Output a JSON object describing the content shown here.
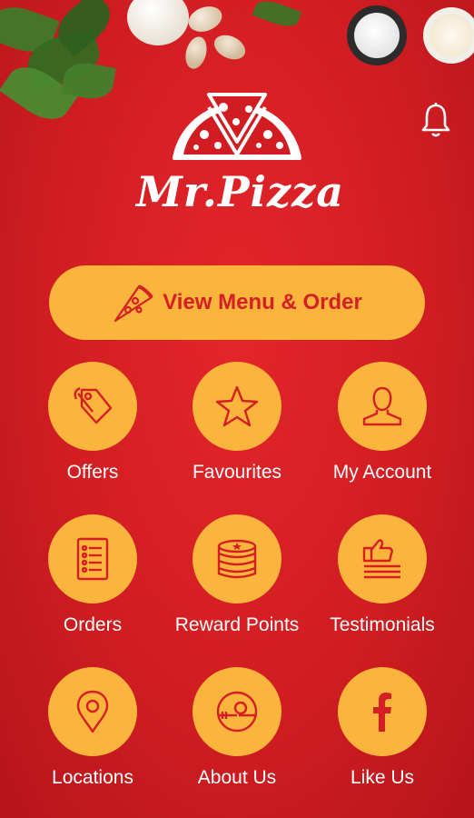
{
  "app": {
    "name": "Mr.Pizza"
  },
  "header": {
    "notification_icon": "bell-icon"
  },
  "cta": {
    "label": "View Menu & Order",
    "icon": "pizza-slice-icon"
  },
  "colors": {
    "background": "#d11d22",
    "accent": "#fbb53c",
    "accent_text": "#d51f25",
    "text": "#ffffff"
  },
  "menu": [
    {
      "label": "Offers",
      "icon": "tag-icon"
    },
    {
      "label": "Favourites",
      "icon": "star-icon"
    },
    {
      "label": "My Account",
      "icon": "user-icon"
    },
    {
      "label": "Orders",
      "icon": "list-icon"
    },
    {
      "label": "Reward Points",
      "icon": "coins-icon"
    },
    {
      "label": "Testimonials",
      "icon": "thumbs-up-icon"
    },
    {
      "label": "Locations",
      "icon": "location-pin-icon"
    },
    {
      "label": "About Us",
      "icon": "plate-icon"
    },
    {
      "label": "Like Us",
      "icon": "facebook-icon"
    }
  ]
}
